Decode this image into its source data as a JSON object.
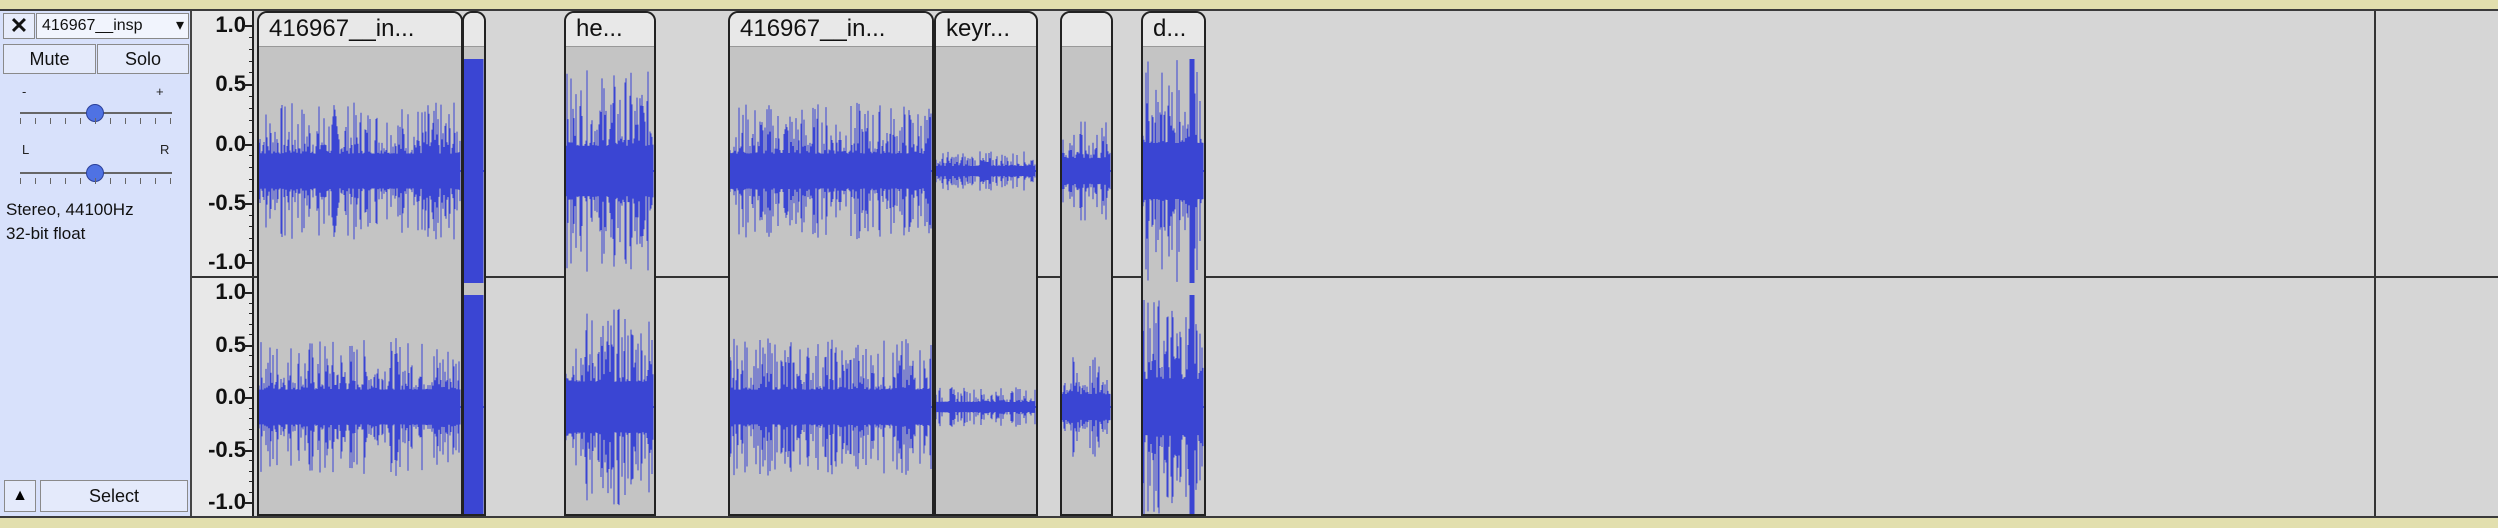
{
  "track_panel": {
    "close_label": "✕",
    "track_name": "416967__insp",
    "menu_arrow": "▾",
    "mute_label": "Mute",
    "solo_label": "Solo",
    "gain_min_label": "-",
    "gain_max_label": "+",
    "pan_left_label": "L",
    "pan_right_label": "R",
    "info_line1": "Stereo, 44100Hz",
    "info_line2": "32-bit float",
    "collapse_icon": "▲",
    "select_label": "Select"
  },
  "ruler": {
    "channel1": [
      "1.0",
      "0.5",
      "0.0",
      "-0.5",
      "-1.0"
    ],
    "channel2": [
      "1.0",
      "0.5",
      "0.0",
      "-0.5",
      "-1.0"
    ]
  },
  "clips": [
    {
      "name": "416967__in...",
      "amp": 0.62
    },
    {
      "name": "",
      "amp": 1.0
    },
    {
      "name": "he...",
      "amp": 0.9
    },
    {
      "name": "416967__in...",
      "amp": 0.62
    },
    {
      "name": "keyr...",
      "amp": 0.18
    },
    {
      "name": "",
      "amp": 0.45
    },
    {
      "name": "d...",
      "amp": 1.0
    }
  ],
  "colors": {
    "waveform": "#3a45d3",
    "panel_bg": "#d8e1fb",
    "clip_bg": "#c4c4c4"
  }
}
